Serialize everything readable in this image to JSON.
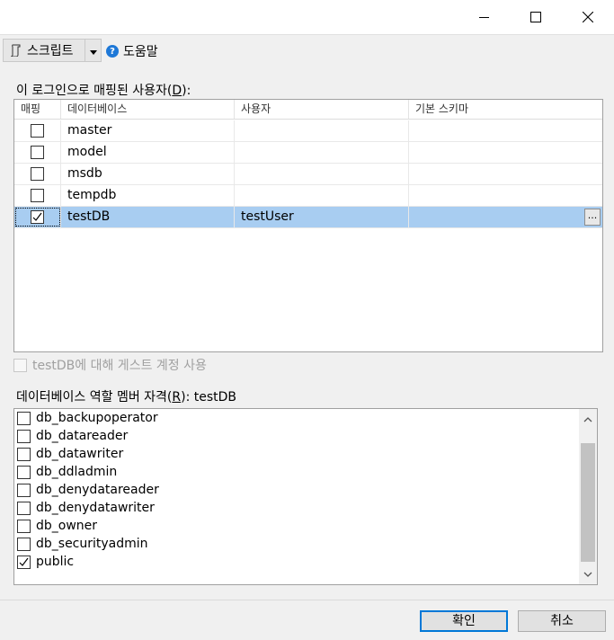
{
  "toolbar": {
    "script_label": "스크립트",
    "help_label": "도움말"
  },
  "mapping": {
    "label_prefix": "이 로그인으로 매핑된 사용자(",
    "label_key": "D",
    "label_suffix": "):",
    "columns": [
      "매핑",
      "데이터베이스",
      "사용자",
      "기본 스키마"
    ],
    "rows": [
      {
        "mapped": false,
        "database": "master",
        "user": "",
        "schema": ""
      },
      {
        "mapped": false,
        "database": "model",
        "user": "",
        "schema": ""
      },
      {
        "mapped": false,
        "database": "msdb",
        "user": "",
        "schema": ""
      },
      {
        "mapped": false,
        "database": "tempdb",
        "user": "",
        "schema": ""
      },
      {
        "mapped": true,
        "database": "testDB",
        "user": "testUser",
        "schema": ""
      }
    ],
    "ellipsis_label": "..."
  },
  "guest": {
    "label": "testDB에 대해 게스트 계정 사용",
    "checked": false
  },
  "roles": {
    "label_prefix": "데이터베이스 역할 멤버 자격(",
    "label_key": "R",
    "label_suffix": "): testDB",
    "items": [
      {
        "name": "db_backupoperator",
        "checked": false
      },
      {
        "name": "db_datareader",
        "checked": false
      },
      {
        "name": "db_datawriter",
        "checked": false
      },
      {
        "name": "db_ddladmin",
        "checked": false
      },
      {
        "name": "db_denydatareader",
        "checked": false
      },
      {
        "name": "db_denydatawriter",
        "checked": false
      },
      {
        "name": "db_owner",
        "checked": false
      },
      {
        "name": "db_securityadmin",
        "checked": false
      },
      {
        "name": "public",
        "checked": true
      }
    ]
  },
  "buttons": {
    "ok": "확인",
    "cancel": "취소"
  },
  "colors": {
    "selection": "#a8cdf1",
    "accent": "#0078d7"
  }
}
